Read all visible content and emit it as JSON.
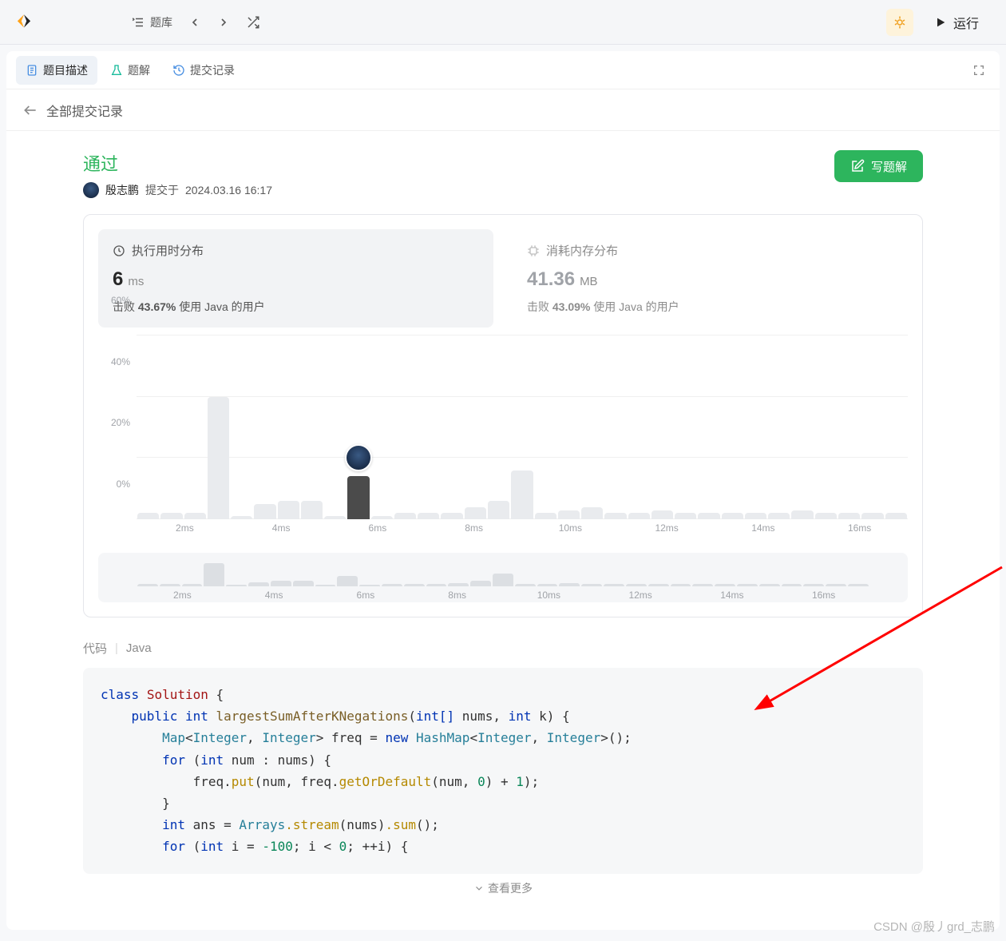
{
  "topbar": {
    "problems": "题库",
    "run": "运行"
  },
  "tabs": {
    "desc": "题目描述",
    "solution": "题解",
    "submissions": "提交记录"
  },
  "subhead": {
    "all_submissions": "全部提交记录"
  },
  "status": {
    "title": "通过",
    "author": "殷志鹏",
    "submitted_prefix": "提交于",
    "time": "2024.03.16 16:17"
  },
  "write_btn": "写题解",
  "runtime_panel": {
    "title": "执行用时分布",
    "value": "6",
    "unit": "ms",
    "beats_prefix": "击败",
    "beats_pct": "43.67%",
    "beats_suffix": "使用 Java 的用户"
  },
  "memory_panel": {
    "title": "消耗内存分布",
    "value": "41.36",
    "unit": "MB",
    "beats_prefix": "击败",
    "beats_pct": "43.09%",
    "beats_suffix": "使用 Java 的用户"
  },
  "chart_data": {
    "type": "bar",
    "ylabel": "%",
    "ylim": [
      0,
      60
    ],
    "y_ticks": [
      "0%",
      "20%",
      "40%",
      "60%"
    ],
    "x_ticks": [
      "2ms",
      "4ms",
      "6ms",
      "8ms",
      "10ms",
      "12ms",
      "14ms",
      "16ms"
    ],
    "bars": [
      2,
      2,
      2,
      40,
      1,
      5,
      6,
      6,
      1,
      14,
      1,
      2,
      2,
      2,
      4,
      6,
      16,
      2,
      3,
      4,
      2,
      2,
      3,
      2,
      2,
      2,
      2,
      2,
      3,
      2,
      2,
      2,
      2
    ],
    "highlight_index": 9,
    "avatar_bar_index": 9,
    "mini_bars": [
      2,
      2,
      2,
      22,
      1,
      4,
      5,
      5,
      1,
      10,
      1,
      2,
      2,
      2,
      3,
      5,
      12,
      2,
      2,
      3,
      2,
      2,
      2,
      2,
      2,
      2,
      2,
      2,
      2,
      2,
      2,
      2,
      2
    ],
    "mini_x_ticks": [
      "2ms",
      "4ms",
      "6ms",
      "8ms",
      "10ms",
      "12ms",
      "14ms",
      "16ms"
    ]
  },
  "code": {
    "label": "代码",
    "lang": "Java",
    "show_more": "查看更多"
  },
  "code_tokens": {
    "kw_class": "class",
    "cls": "Solution",
    "brace_o": "{",
    "kw_public": "public",
    "t_int": "int",
    "fn": "largestSumAfterKNegations",
    "p_o": "(",
    "t_intarr": "int[]",
    "arg_nums": "nums",
    "comma": ",",
    "arg_k": "k",
    "p_c": ")",
    "t_map": "Map",
    "lt": "<",
    "t_Integer": "Integer",
    "gt": ">",
    "v_freq": "freq",
    "eq": "=",
    "kw_new": "new",
    "t_HashMap": "HashMap",
    "ctor": "();",
    "kw_for": "for",
    "t_int2": "int",
    "v_num": "num",
    "colon": ":",
    "v_nums": "nums",
    "m_put": "put",
    "m_getOrDefault": "getOrDefault",
    "n0": "0",
    "plus": "+",
    "n1": "1",
    "v_ans": "ans",
    "t_Arrays": "Arrays",
    "m_stream": ".stream",
    "m_sum": ".sum",
    "v_i": "i",
    "nneg100": "-100",
    "lt2": "<",
    "inc": "++i"
  },
  "watermark": "CSDN @殷丿grd_志鹏"
}
